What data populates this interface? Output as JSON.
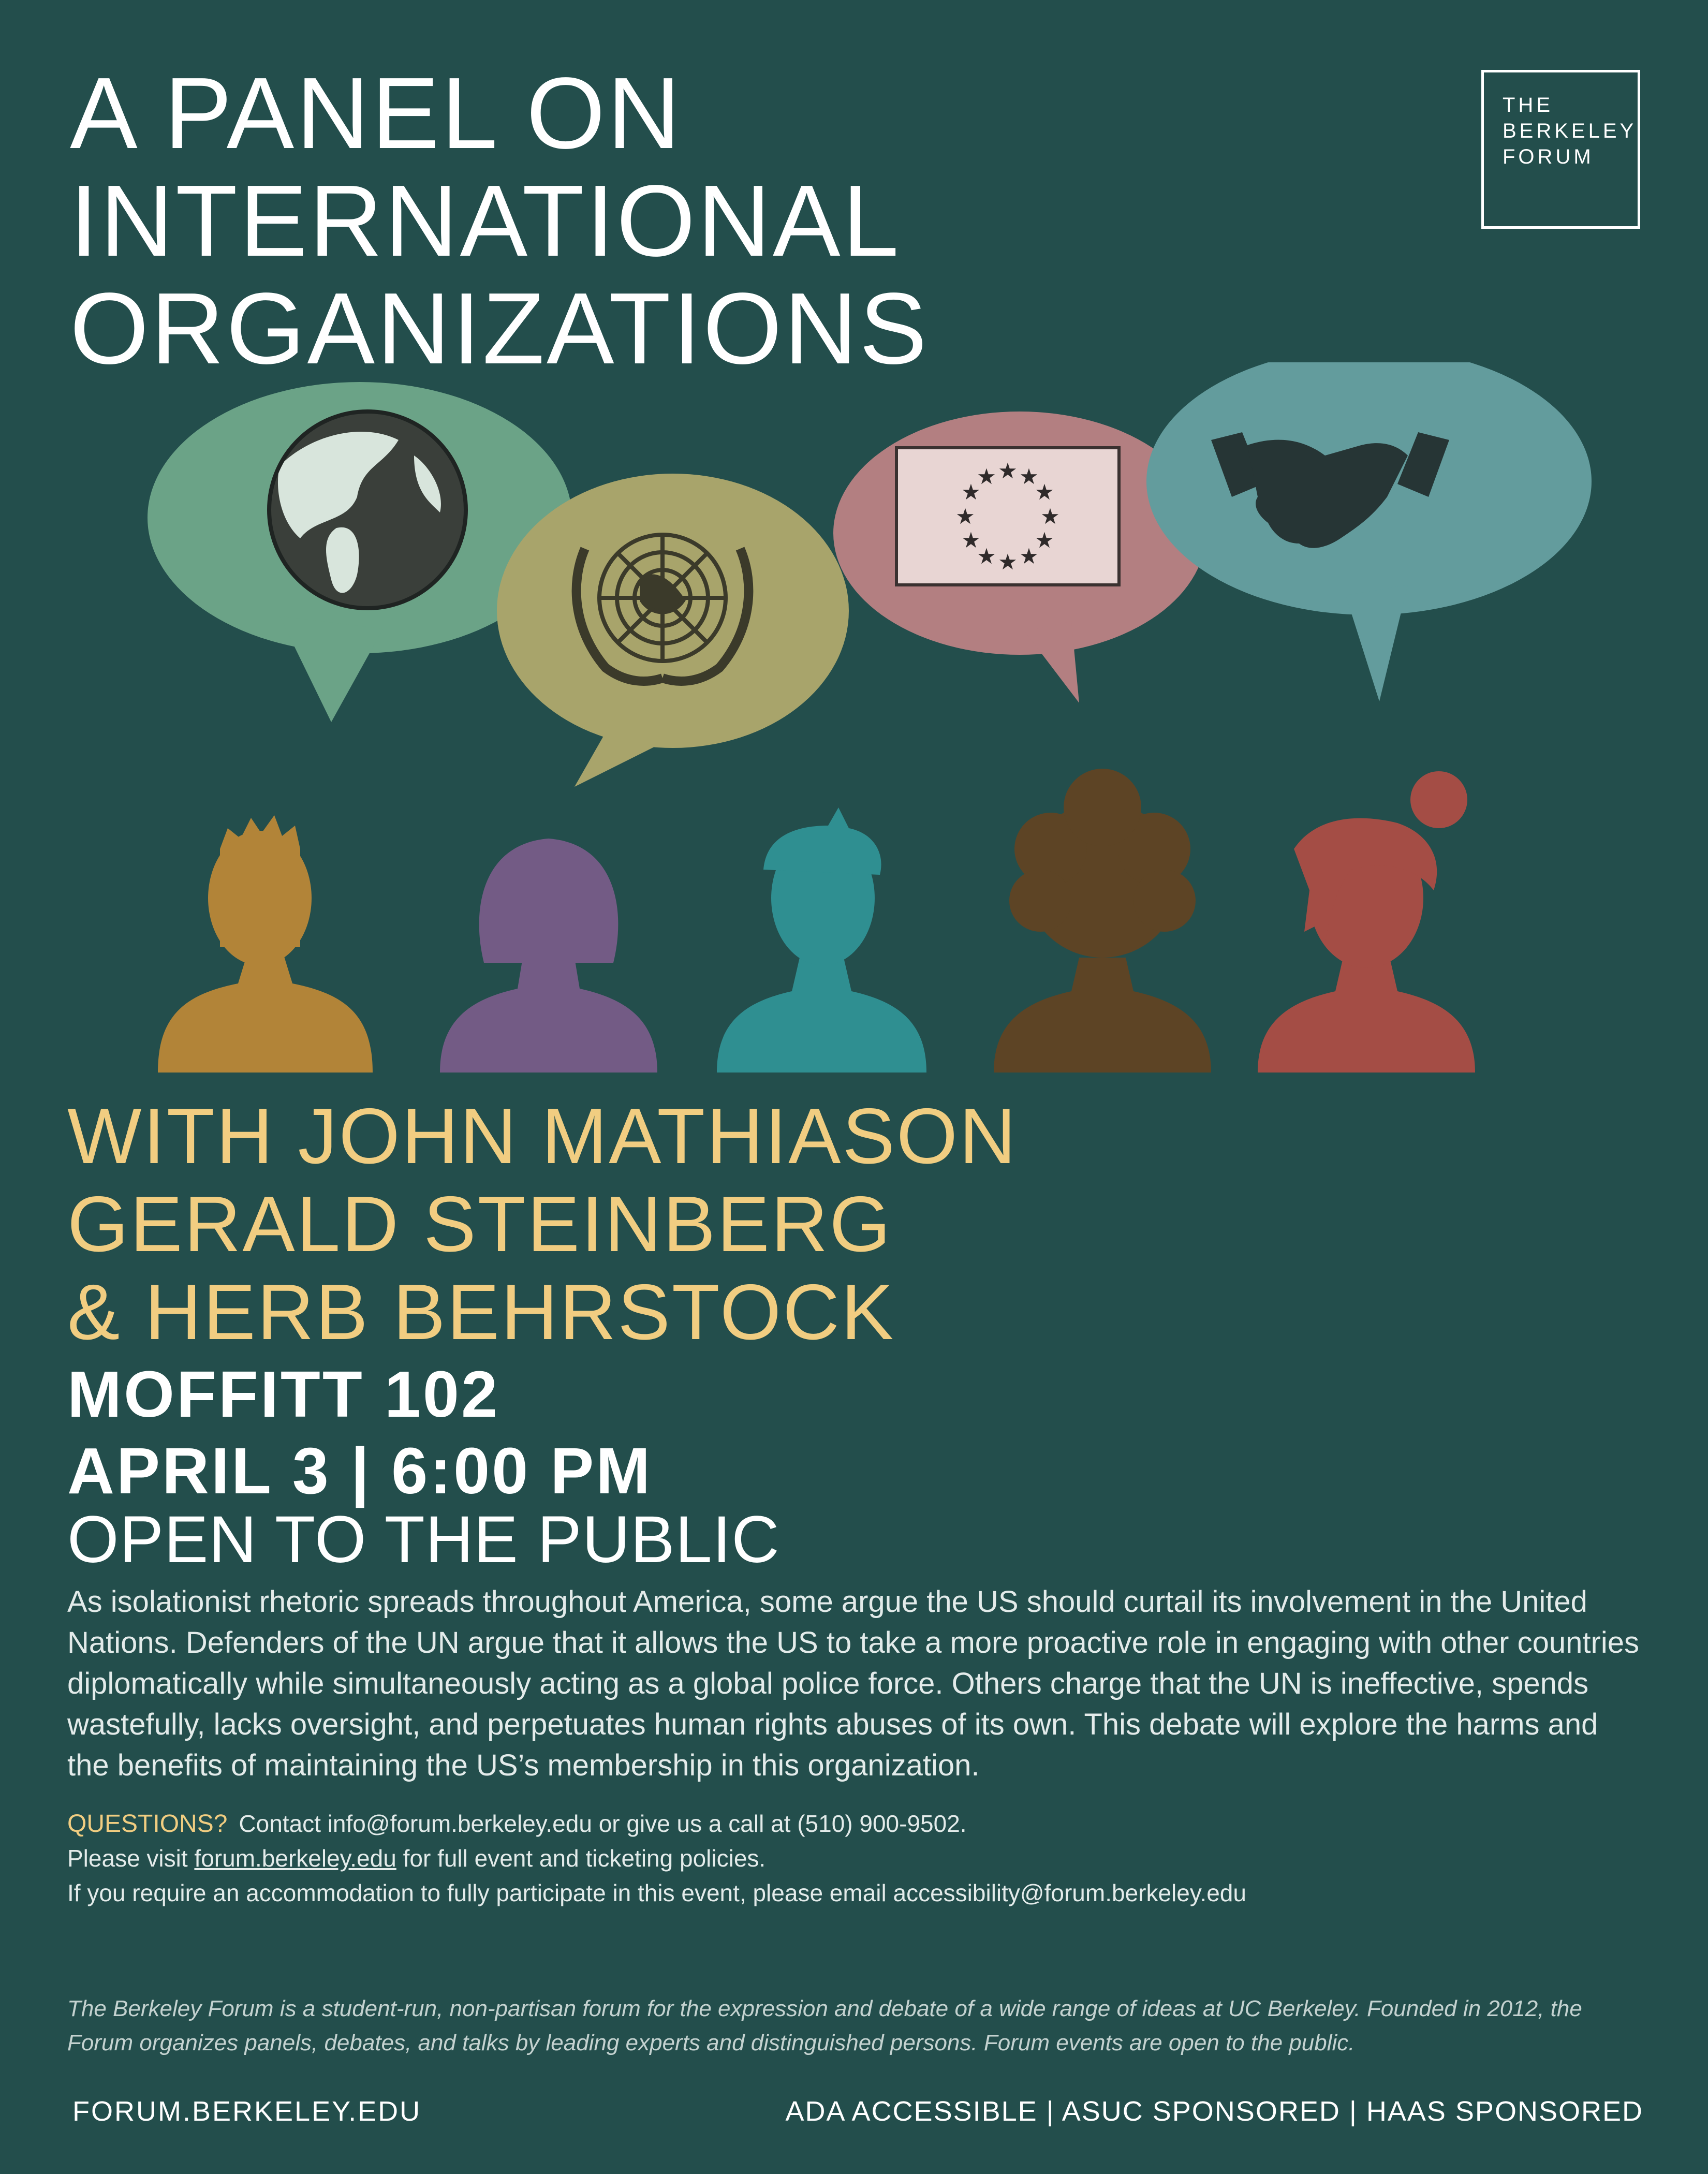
{
  "title": {
    "line1": "A PANEL ON",
    "line2": "INTERNATIONAL",
    "line3": "ORGANIZATIONS"
  },
  "logo": {
    "line1": "THE",
    "line2": "BERKELEY",
    "line3": "FORUM"
  },
  "illustration": {
    "bubbles": [
      {
        "icon": "globe-icon",
        "color": "#6ba387"
      },
      {
        "icon": "un-emblem-icon",
        "color": "#a8a46b"
      },
      {
        "icon": "eu-flag-icon",
        "color": "#b37f81"
      },
      {
        "icon": "handshake-icon",
        "color": "#639c9d"
      }
    ],
    "people": [
      {
        "icon": "person-spiky-hair-icon",
        "color": "#b28438"
      },
      {
        "icon": "person-bob-hair-icon",
        "color": "#735b85"
      },
      {
        "icon": "person-quiff-hair-icon",
        "color": "#2f8f91"
      },
      {
        "icon": "person-curly-hair-icon",
        "color": "#5d4425"
      },
      {
        "icon": "person-bun-hair-icon",
        "color": "#a44d45"
      }
    ]
  },
  "speakers": {
    "line1": "WITH JOHN MATHIASON",
    "line2": "GERALD STEINBERG",
    "line3": "& HERB BEHRSTOCK"
  },
  "event": {
    "location": "MOFFITT 102",
    "datetime": "APRIL 3 | 6:00 PM",
    "admission": "OPEN TO THE PUBLIC"
  },
  "description": "As isolationist rhetoric spreads throughout America, some argue the US should curtail its involvement in the United Nations. Defenders of the UN argue that it allows the US to take a more proactive role in engaging with other countries diplomatically while simultaneously acting as a global police force. Others charge that the UN is ineffective, spends wastefully, lacks oversight, and perpetuates human rights abuses of its own. This debate will explore the harms and the benefits of maintaining the US’s membership in this organization.",
  "contact": {
    "questions_label": "QUESTIONS?",
    "questions_text": "Contact info@forum.berkeley.edu or give us a call at (510) 900-9502.",
    "visit_prefix": "Please visit",
    "visit_link": "forum.berkeley.edu",
    "visit_suffix": "for full event and ticketing policies.",
    "accommodation": "If you require an accommodation to fully participate in this event, please email accessibility@forum.berkeley.edu"
  },
  "about": "The Berkeley Forum is a student-run, non-partisan forum for the expression and debate of a wide range of ideas at UC Berkeley. Founded in 2012, the Forum organizes panels, debates, and talks by leading experts and distinguished persons. Forum events are open to the public.",
  "footer": {
    "website": "FORUM.BERKELEY.EDU",
    "badges": "ADA ACCESSIBLE | ASUC SPONSORED | HAAS SPONSORED"
  },
  "colors": {
    "background": "#234e4c",
    "accent_gold": "#f1cd81",
    "text": "#ffffff"
  }
}
